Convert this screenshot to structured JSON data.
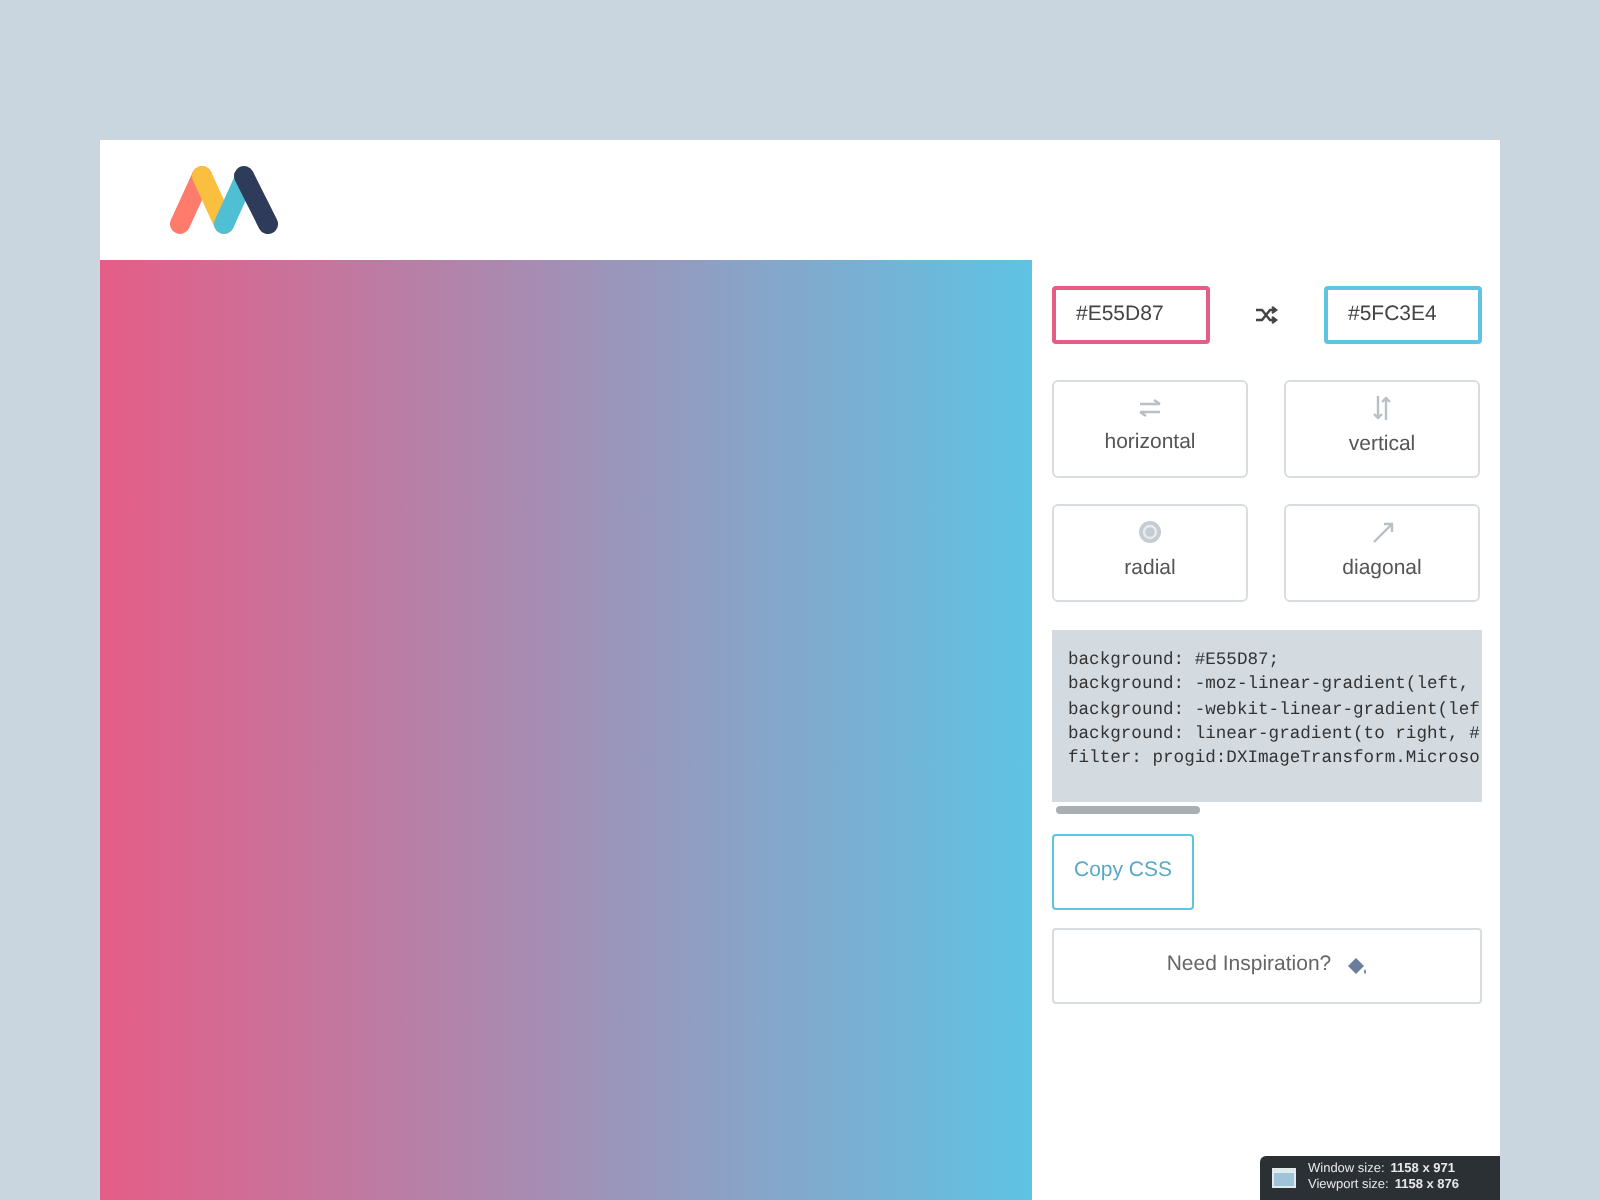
{
  "color_fields": [
    {
      "value": "#E55D87"
    },
    {
      "value": "#5FC3E4"
    }
  ],
  "directions": [
    {
      "kind": "horizontal",
      "label": "horizontal"
    },
    {
      "kind": "vertical",
      "label": "vertical"
    },
    {
      "kind": "radial",
      "label": "radial"
    },
    {
      "kind": "diagonal",
      "label": "diagonal"
    }
  ],
  "css_lines": [
    "background: #E55D87;",
    "background: -moz-linear-gradient(left,",
    "background: -webkit-linear-gradient(lef",
    "background: linear-gradient(to right, #",
    "filter: progid:DXImageTransform.Microso"
  ],
  "copy_button": "Copy CSS",
  "inspiration_button": "Need Inspiration?",
  "size_overlay": [
    {
      "label": "Window size:",
      "value": "1158 x 971"
    },
    {
      "label": "Viewport size:",
      "value": "1158 x 876"
    }
  ]
}
